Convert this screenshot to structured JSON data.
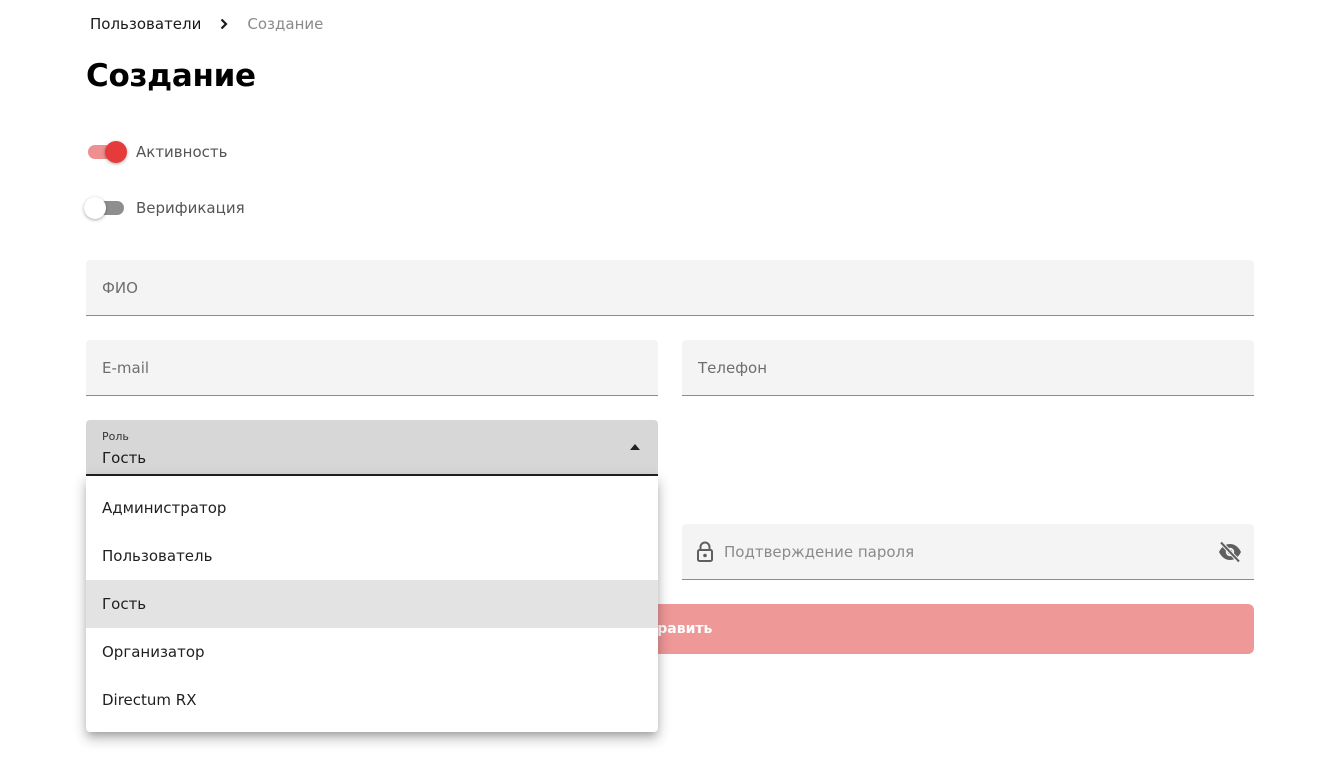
{
  "breadcrumb": {
    "parent": "Пользователи",
    "current": "Создание"
  },
  "page": {
    "title": "Создание"
  },
  "toggles": {
    "active": {
      "label": "Активность",
      "on": true
    },
    "verification": {
      "label": "Верификация",
      "on": false
    }
  },
  "fields": {
    "full_name": {
      "placeholder": "ФИО",
      "value": ""
    },
    "email": {
      "placeholder": "E-mail",
      "value": ""
    },
    "phone": {
      "placeholder": "Телефон",
      "value": ""
    },
    "password_confirm": {
      "placeholder": "Подтверждение пароля",
      "value": ""
    }
  },
  "role_select": {
    "label": "Роль",
    "selected": "Гость",
    "options": [
      "Администратор",
      "Пользователь",
      "Гость",
      "Организатор",
      "Directum RX"
    ]
  },
  "submit": {
    "label": "Отправить"
  },
  "icons": {
    "breadcrumb_separator": "chevron-right-icon",
    "select_toggle": "arrow-drop-up-icon",
    "password_prefix": "lock-icon",
    "password_visibility": "eye-off-icon"
  },
  "colors": {
    "accent": "#e53b3b",
    "accent_track": "#ef8f8f",
    "button_disabled": "#ef9898",
    "field_bg": "#f4f4f4",
    "select_bg": "#d7d7d7",
    "menu_selected_bg": "#e3e3e3"
  }
}
